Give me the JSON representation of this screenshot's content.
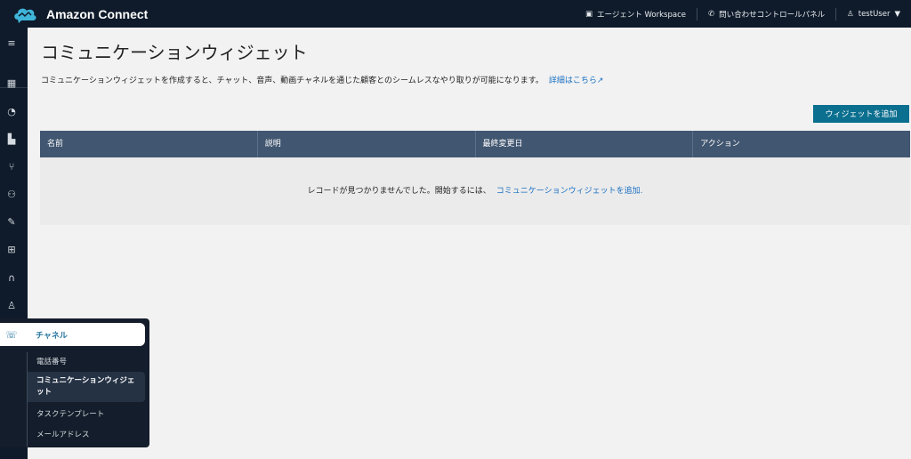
{
  "header": {
    "brand": "Amazon Connect",
    "agent_workspace": "エージェント Workspace",
    "contact_control_panel": "問い合わせコントロールパネル",
    "user": "testUser"
  },
  "sidebar": {
    "icons": [
      "menu-icon",
      "dashboard-icon",
      "clock-icon",
      "analytics-icon",
      "routing-icon",
      "users-icon",
      "rocket-icon",
      "integration-icon",
      "headset-icon",
      "person-icon"
    ]
  },
  "page": {
    "title": "コミュニケーションウィジェット",
    "description": "コミュニケーションウィジェットを作成すると、チャット、音声、動画チャネルを通じた顧客とのシームレスなやり取りが可能になります。",
    "learn_more": "詳細はこちら",
    "add_button": "ウィジェットを追加"
  },
  "table": {
    "columns": [
      "名前",
      "説明",
      "最終変更日",
      "アクション"
    ],
    "empty_text": "レコードが見つかりませんでした。開始するには、",
    "empty_link": "コミュニケーションウィジェットを追加."
  },
  "flyout": {
    "title": "チャネル",
    "items": [
      {
        "label": "電話番号"
      },
      {
        "label": "コミュニケーションウィジェット",
        "active": true
      },
      {
        "label": "タスクテンプレート"
      },
      {
        "label": "メールアドレス"
      }
    ]
  },
  "colors": {
    "topbar": "#0f1b2a",
    "primary_button": "#0b6f8f",
    "table_header": "#415670",
    "link": "#1a6fc2"
  }
}
